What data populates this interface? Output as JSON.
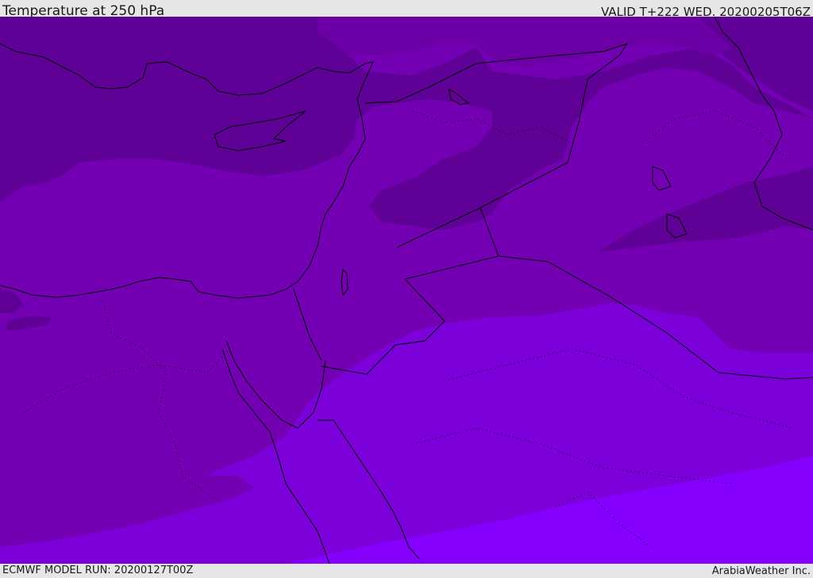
{
  "header": {
    "title": "Temperature at 250 hPa",
    "valid_time": "VALID T+222 WED. 20200205T06Z"
  },
  "footer": {
    "model_run": "ECMWF MODEL RUN: 20200127T00Z",
    "credit": "ArabiaWeather Inc."
  },
  "map": {
    "variable": "temperature",
    "pressure_level_hPa": 250,
    "shading_colors": {
      "coldest": "#5f0096",
      "cold": "#6c00a6",
      "mid": "#7200b3",
      "mid_warm": "#7a00cc",
      "warm": "#8000e0",
      "warmest": "#8500ff"
    },
    "coastline_color": "#000000",
    "border_style": "dotted"
  }
}
